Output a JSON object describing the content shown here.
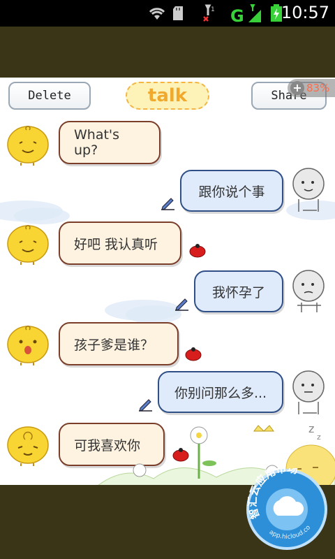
{
  "status_bar": {
    "time": "10:57",
    "network": "G",
    "icons": [
      "wifi-icon",
      "sd-card-icon",
      "no-signal-icon",
      "signal-icon",
      "battery-charging-icon"
    ]
  },
  "toolbar": {
    "delete_label": "Delete",
    "logo_text": "talk",
    "share_label": "Share",
    "zoom_text": "83%"
  },
  "messages": [
    {
      "side": "left",
      "text": "What's up?"
    },
    {
      "side": "right",
      "text": "跟你说个事"
    },
    {
      "side": "left",
      "text": "好吧 我认真听"
    },
    {
      "side": "right",
      "text": "我怀孕了"
    },
    {
      "side": "left",
      "text": "孩子爹是谁？"
    },
    {
      "side": "right",
      "text": "你别问那么多..."
    },
    {
      "side": "left",
      "text": "可我喜欢你"
    }
  ],
  "colors": {
    "band": "#3b3518",
    "left_bubble": "#fdf3e0",
    "right_bubble": "#dfebfb",
    "logo": "#f0a92c"
  },
  "market_badge": {
    "title": "智汇云应用市场",
    "url": "app.hicloud.com"
  }
}
